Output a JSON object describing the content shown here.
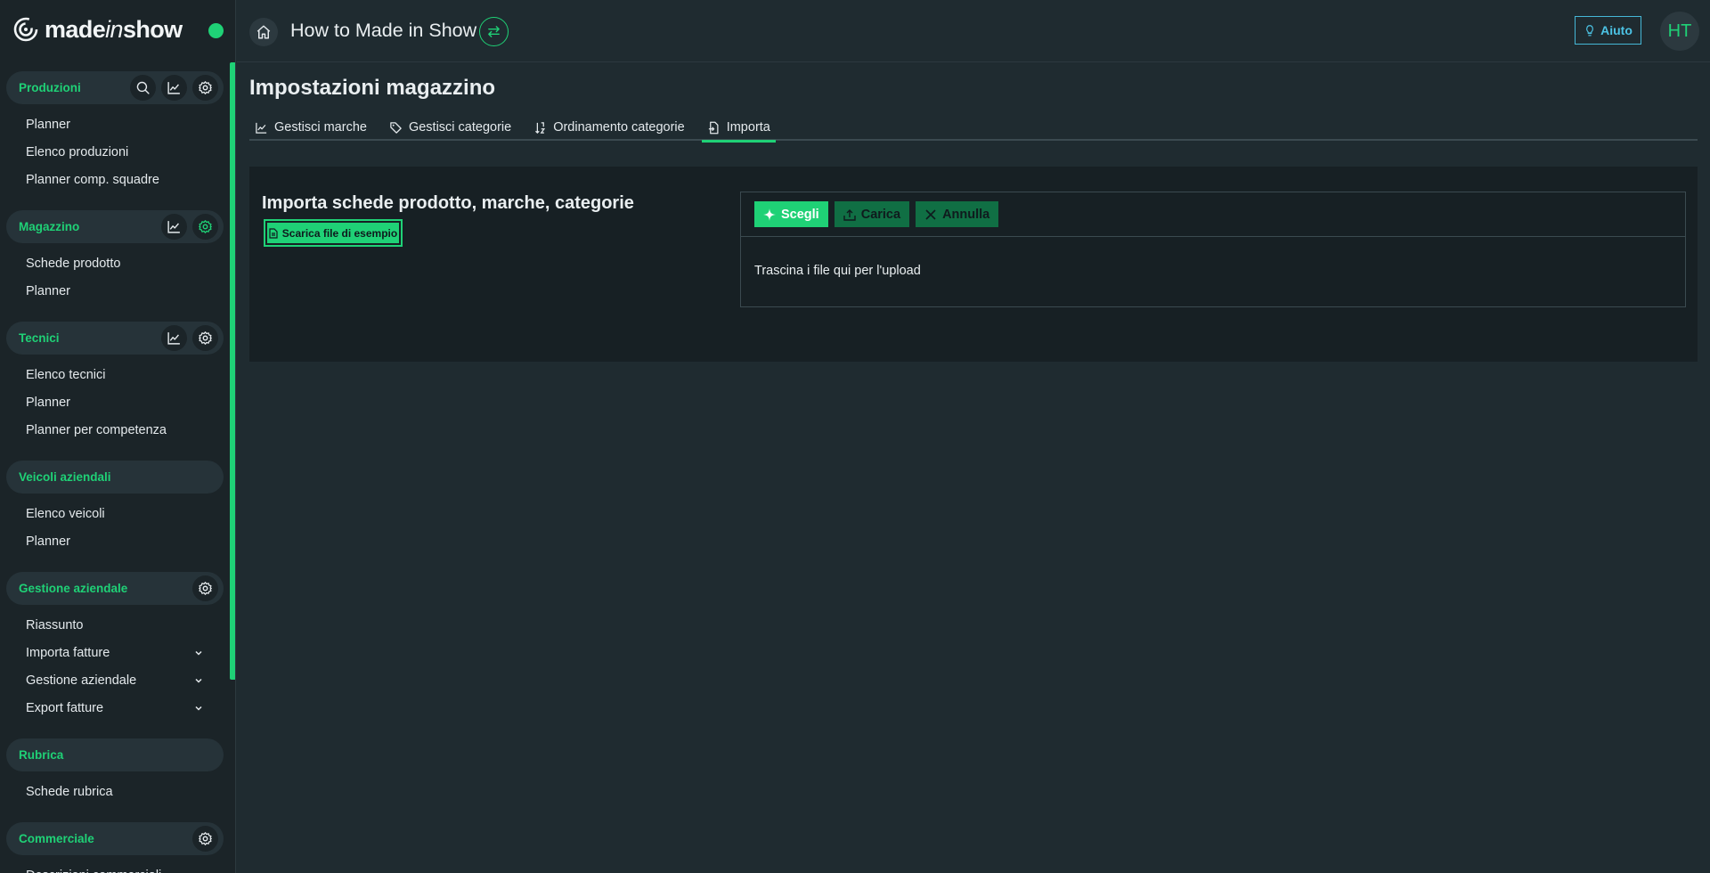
{
  "brand": {
    "name_prefix": "made",
    "name_italic": "in",
    "name_suffix": "show"
  },
  "header": {
    "title": "How to Made in Show",
    "help_label": "Aiuto",
    "avatar_initials": "HT"
  },
  "sidebar": {
    "sections": [
      {
        "label": "Produzioni",
        "tools": [
          "search-icon",
          "chart-icon",
          "gear-icon"
        ],
        "items": [
          "Planner",
          "Elenco produzioni",
          "Planner comp. squadre"
        ]
      },
      {
        "label": "Magazzino",
        "tools": [
          "chart-icon",
          "gear-icon"
        ],
        "items": [
          "Schede prodotto",
          "Planner"
        ]
      },
      {
        "label": "Tecnici",
        "tools": [
          "chart-icon",
          "gear-icon"
        ],
        "items": [
          "Elenco tecnici",
          "Planner",
          "Planner per competenza"
        ]
      },
      {
        "label": "Veicoli aziendali",
        "tools": [],
        "items": [
          "Elenco veicoli",
          "Planner"
        ]
      },
      {
        "label": "Gestione aziendale",
        "tools": [
          "gear-icon"
        ],
        "items": [
          "Riassunto",
          "Importa fatture",
          "Gestione aziendale",
          "Export fatture"
        ]
      },
      {
        "label": "Rubrica",
        "tools": [],
        "items": [
          "Schede rubrica"
        ]
      },
      {
        "label": "Commerciale",
        "tools": [
          "gear-icon"
        ],
        "items": [
          "Descrizioni commerciali"
        ]
      }
    ]
  },
  "main": {
    "title": "Impostazioni magazzino",
    "tabs": [
      {
        "label": "Gestisci marche",
        "icon": "chart-icon"
      },
      {
        "label": "Gestisci categorie",
        "icon": "tag-icon"
      },
      {
        "label": "Ordinamento categorie",
        "icon": "sort-icon"
      },
      {
        "label": "Importa",
        "icon": "file-import-icon",
        "active": true
      }
    ],
    "import": {
      "title": "Importa schede prodotto, marche, categorie",
      "sample_button": "Scarica file di esempio",
      "choose_label": "Scegli",
      "upload_label": "Carica",
      "cancel_label": "Annulla",
      "drop_hint": "Trascina i file qui per l'upload"
    }
  },
  "colors": {
    "accent": "#1fd176",
    "help": "#4cc3e4",
    "background": "#1f2b30",
    "sidebar": "#1b2428"
  }
}
